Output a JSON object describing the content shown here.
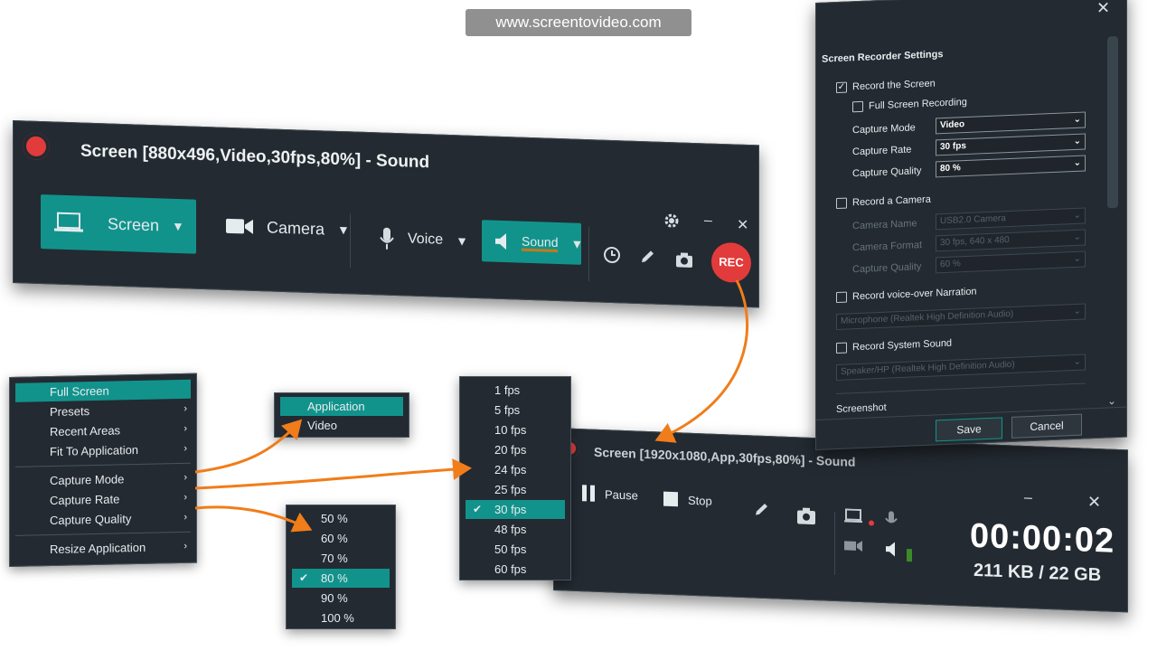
{
  "website": "www.screentovideo.com",
  "recorder": {
    "title": "Screen [880x496,Video,30fps,80%] - Sound",
    "screen_label": "Screen",
    "camera_label": "Camera",
    "voice_label": "Voice",
    "sound_label": "Sound",
    "rec_label": "REC"
  },
  "main_menu": {
    "items": [
      "Full Screen",
      "Presets",
      "Recent Areas",
      "Fit To Application",
      "Capture Mode",
      "Capture Rate",
      "Capture Quality",
      "Resize Application"
    ],
    "selected": "Full Screen"
  },
  "capture_mode_menu": {
    "items": [
      "Application",
      "Video"
    ],
    "highlighted": "Application",
    "checked": "Video"
  },
  "fps_menu": {
    "items": [
      "1 fps",
      "5 fps",
      "10 fps",
      "20 fps",
      "24 fps",
      "25 fps",
      "30 fps",
      "48 fps",
      "50 fps",
      "60 fps"
    ],
    "selected": "30 fps"
  },
  "quality_menu": {
    "items": [
      "50 %",
      "60 %",
      "70 %",
      "80 %",
      "90 %",
      "100 %"
    ],
    "selected": "80 %"
  },
  "recording_bar": {
    "title": "Screen [1920x1080,App,30fps,80%] - Sound",
    "pause_label": "Pause",
    "stop_label": "Stop",
    "timer": "00:00:02",
    "size": "211 KB / 22 GB"
  },
  "settings": {
    "title": "Screen Recorder Settings",
    "record_screen": "Record the Screen",
    "full_screen": "Full Screen Recording",
    "capture_mode_label": "Capture Mode",
    "capture_mode_value": "Video",
    "capture_rate_label": "Capture Rate",
    "capture_rate_value": "30 fps",
    "capture_quality_label": "Capture Quality",
    "capture_quality_value": "80 %",
    "record_camera": "Record a Camera",
    "camera_name_label": "Camera Name",
    "camera_name_value": "USB2.0 Camera",
    "camera_format_label": "Camera Format",
    "camera_format_value": "30 fps, 640 x 480",
    "camera_quality_label": "Capture Quality",
    "camera_quality_value": "60 %",
    "record_voice": "Record voice-over Narration",
    "voice_device": "Microphone (Realtek High Definition Audio)",
    "record_sound": "Record System Sound",
    "sound_device": "Speaker/HP (Realtek High Definition Audio)",
    "screenshot_label": "Screenshot",
    "save_label": "Save",
    "cancel_label": "Cancel"
  },
  "colors": {
    "panel": "#232a31",
    "accent_teal": "#11938c",
    "record_red": "#e23b3b",
    "arrow_orange": "#f07d1a"
  }
}
